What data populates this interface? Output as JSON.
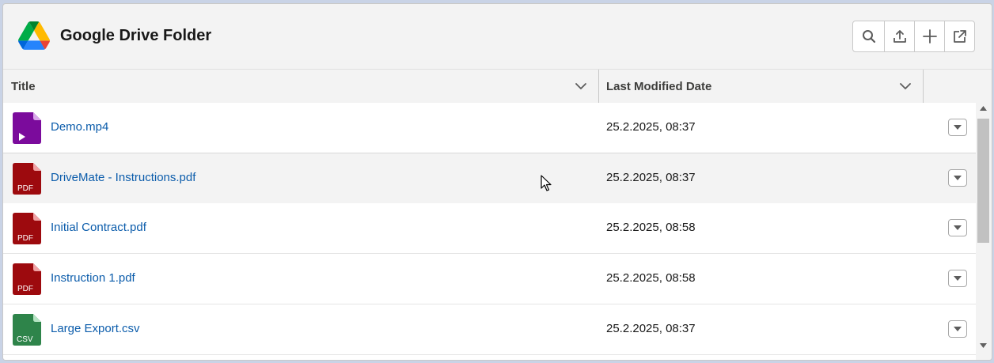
{
  "header": {
    "title": "Google Drive Folder",
    "logo_icon": "google-drive-icon",
    "actions": [
      {
        "name": "search-button",
        "icon": "search-icon"
      },
      {
        "name": "upload-button",
        "icon": "upload-icon"
      },
      {
        "name": "new-button",
        "icon": "plus-icon"
      },
      {
        "name": "open-external-button",
        "icon": "external-link-icon"
      }
    ]
  },
  "table": {
    "columns": [
      {
        "label": "Title",
        "icon": "chevron-down-icon"
      },
      {
        "label": "Last Modified Date",
        "icon": "chevron-down-icon"
      }
    ],
    "rows": [
      {
        "name": "Demo.mp4",
        "type": "video",
        "date": "25.2.2025, 08:37"
      },
      {
        "name": "DriveMate - Instructions.pdf",
        "type": "pdf",
        "type_label": "PDF",
        "date": "25.2.2025, 08:37"
      },
      {
        "name": "Initial Contract.pdf",
        "type": "pdf",
        "type_label": "PDF",
        "date": "25.2.2025, 08:58"
      },
      {
        "name": "Instruction 1.pdf",
        "type": "pdf",
        "type_label": "PDF",
        "date": "25.2.2025, 08:58"
      },
      {
        "name": "Large Export.csv",
        "type": "csv",
        "type_label": "CSV",
        "date": "25.2.2025, 08:37"
      }
    ],
    "hovered_row": 1
  },
  "colors": {
    "link": "#0b5cab",
    "video": "#7b0b9c",
    "pdf": "#9d0a0e",
    "csv": "#2e844a"
  }
}
